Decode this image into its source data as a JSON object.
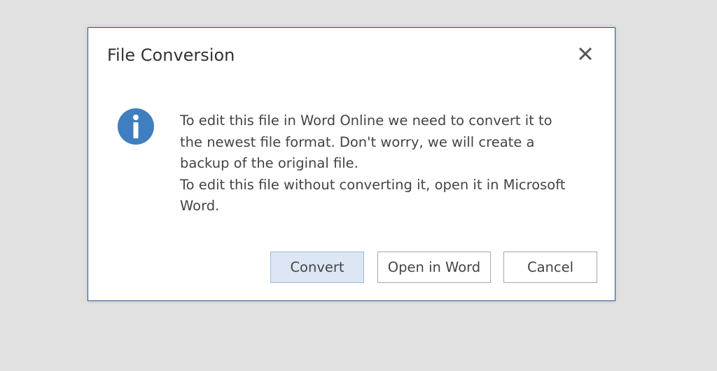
{
  "dialog": {
    "title": "File Conversion",
    "close_icon": "close-icon",
    "info_icon": "info-icon",
    "message_lines": [
      "To edit this file in Word Online we need to convert it to",
      "the newest file format. Don't worry, we will create a",
      "backup of the original file.",
      "To edit this file without converting it, open it in Microsoft",
      "Word."
    ],
    "buttons": {
      "convert": "Convert",
      "open_in_word": "Open in Word",
      "cancel": "Cancel"
    }
  },
  "colors": {
    "accent": "#2b579a",
    "info_icon": "#3f7fbf",
    "primary_button_bg": "#dce6f4",
    "backdrop": "#e1e1e1"
  }
}
